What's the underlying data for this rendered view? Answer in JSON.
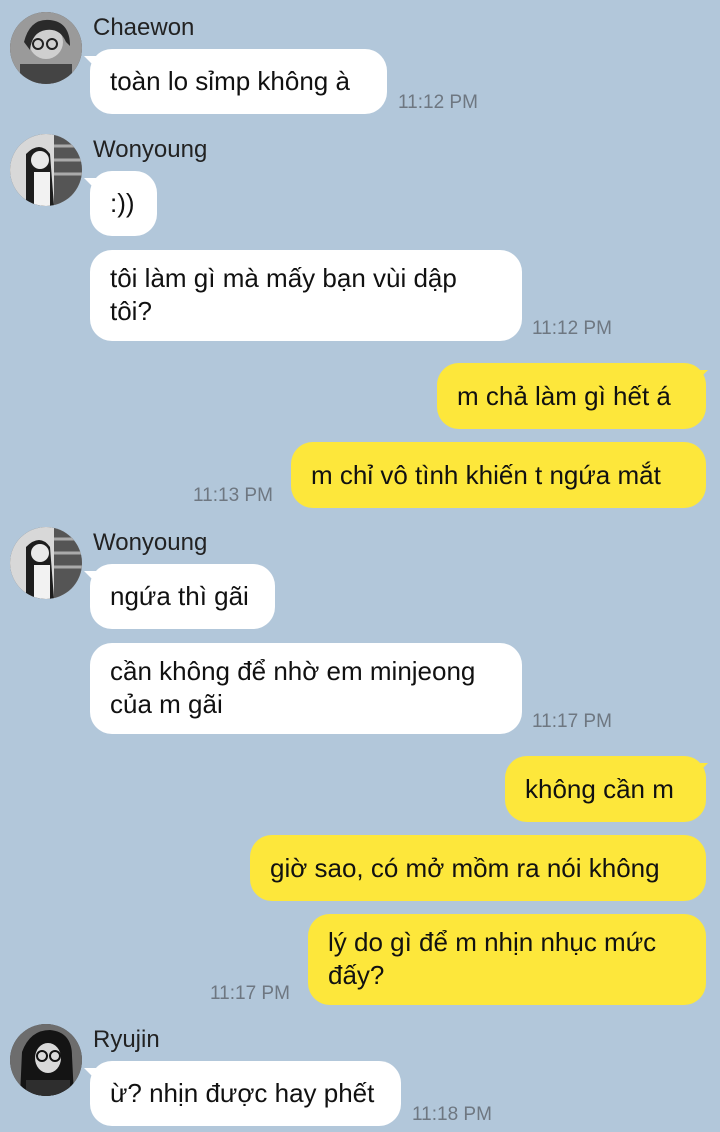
{
  "messages": [
    {
      "sender": "Chaewon",
      "text": "toàn lo sỉmp không à",
      "time": "11:12 PM"
    },
    {
      "sender": "Wonyoung",
      "text": ":))"
    },
    {
      "text": "tôi làm gì mà mấy bạn vùi dập tôi?",
      "time": "11:12 PM"
    },
    {
      "text": "m chả làm gì hết á"
    },
    {
      "text": "m chỉ vô tình khiến t ngứa mắt",
      "time": "11:13 PM"
    },
    {
      "sender": "Wonyoung",
      "text": "ngứa thì gãi"
    },
    {
      "text": "cần không để nhờ em minjeong của m gãi",
      "time": "11:17 PM"
    },
    {
      "text": "không cần m"
    },
    {
      "text": "giờ sao, có mở mồm ra nói không"
    },
    {
      "text": "lý do gì để m nhịn nhục mức đấy?",
      "time": "11:17 PM"
    },
    {
      "sender": "Ryujin",
      "text": "ừ? nhịn được hay phết",
      "time": "11:18 PM"
    }
  ],
  "colors": {
    "background": "#b2c7da",
    "incoming_bubble": "#ffffff",
    "outgoing_bubble": "#fde73b",
    "timestamp": "#6e7781"
  },
  "icons": [
    "avatar-chaewon",
    "avatar-wonyoung",
    "avatar-ryujin"
  ]
}
